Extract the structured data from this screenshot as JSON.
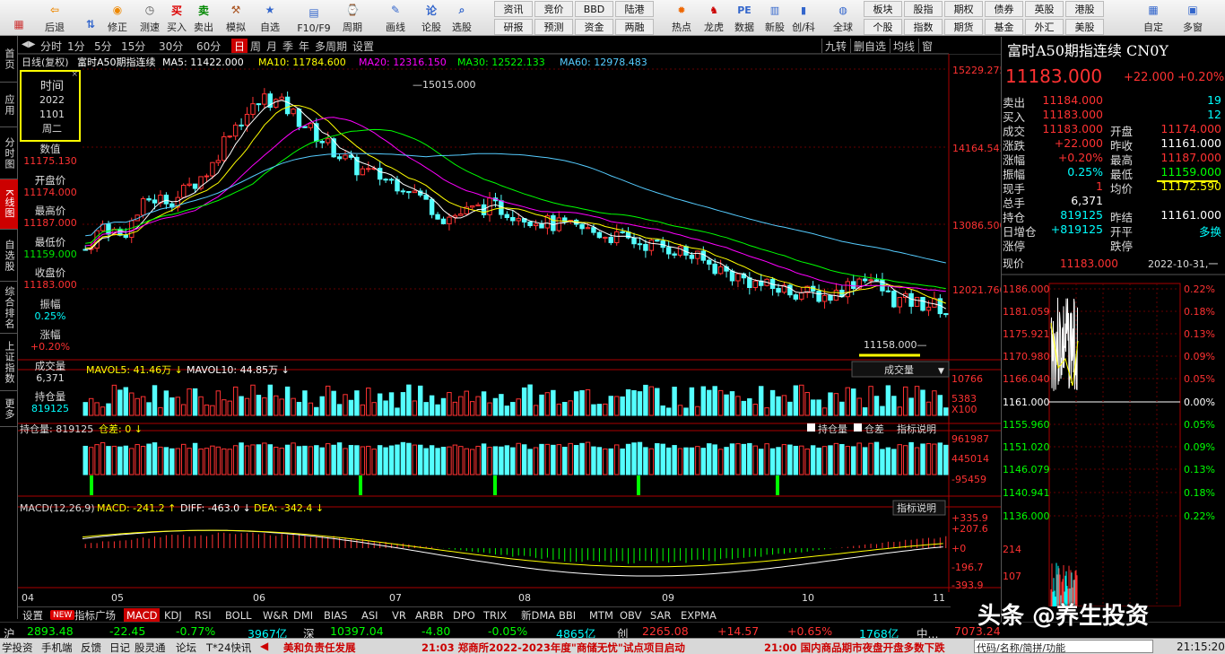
{
  "toolbar": {
    "items": [
      {
        "label": "",
        "icon": "grid-icon"
      },
      {
        "label": "后退",
        "icon": "back-arrow-icon"
      },
      {
        "label": "",
        "icon": "updown-icon"
      },
      {
        "label": "修正",
        "icon": "correct-icon"
      },
      {
        "label": "测速",
        "icon": "clock-icon"
      },
      {
        "label": "买入",
        "icon": "buy-icon",
        "glyph": "买"
      },
      {
        "label": "卖出",
        "icon": "sell-icon",
        "glyph": "卖"
      },
      {
        "label": "模拟",
        "icon": "hammer-icon"
      },
      {
        "label": "自选",
        "icon": "star-icon"
      },
      {
        "label": "F10/F9",
        "icon": "window-icon"
      },
      {
        "label": "周期",
        "icon": "period-icon"
      },
      {
        "label": "画线",
        "icon": "pen-icon"
      },
      {
        "label": "论股",
        "icon": "discuss-icon",
        "glyph": "论"
      },
      {
        "label": "选股",
        "icon": "search-icon"
      }
    ],
    "grid1": [
      [
        "资讯",
        "竞价",
        "BBD",
        "陆港"
      ],
      [
        "研报",
        "预测",
        "资金",
        "两融"
      ]
    ],
    "icons2": [
      {
        "label": "热点",
        "icon": "hot-icon"
      },
      {
        "label": "龙虎",
        "icon": "dragon-icon"
      },
      {
        "label": "数据",
        "icon": "pe-icon",
        "glyph": "PE"
      },
      {
        "label": "新股",
        "icon": "newstock-icon"
      },
      {
        "label": "创/科",
        "icon": "bar-icon"
      },
      {
        "label": "全球",
        "icon": "globe-icon"
      }
    ],
    "grid2": [
      [
        "板块",
        "股指",
        "期权",
        "债券",
        "英股",
        "港股"
      ],
      [
        "个股",
        "指数",
        "期货",
        "基金",
        "外汇",
        "美股"
      ]
    ],
    "icons3": [
      {
        "label": "自定",
        "icon": "custom-icon"
      },
      {
        "label": "多窗",
        "icon": "multiwindow-icon"
      }
    ]
  },
  "left_tabs": [
    "首页",
    "应用",
    "分时图",
    "K线图",
    "自选股",
    "综合排名",
    "上证指数",
    "更多"
  ],
  "periods": [
    "分时",
    "1分",
    "5分",
    "15分",
    "30分",
    "60分",
    "日",
    "周",
    "月",
    "季",
    "年",
    "多周期",
    "设置"
  ],
  "period_active": "日",
  "chart_tools": [
    "九转",
    "删自选",
    "均线",
    "窗"
  ],
  "ma_line": {
    "prefix": "日线(复权)",
    "name": "富时A50期指连续",
    "ma5": "MA5: 11422.000",
    "ma10": "MA10: 11784.600",
    "ma20": "MA20: 12316.150",
    "ma30": "MA30: 12522.133",
    "ma60": "MA60: 12978.483"
  },
  "price_axis": [
    "15229.275",
    "14164.543",
    "13086.500",
    "12021.760"
  ],
  "high_marker": "15015.000",
  "low_marker": "11158.000",
  "data_window": {
    "labels": [
      "时间",
      "数值",
      "开盘价",
      "最高价",
      "最低价",
      "收盘价",
      "振幅",
      "涨幅",
      "成交量",
      "持仓量"
    ],
    "date": [
      "2022",
      "1101",
      "周二"
    ],
    "values": [
      "11175.130",
      "11174.000",
      "11187.000",
      "11159.000",
      "11183.000",
      "0.25%",
      "+0.20%",
      "6,371",
      "819125"
    ]
  },
  "volume": {
    "mavol5": "MAVOL5: 41.46万",
    "mavol10": "MAVOL10: 44.85万",
    "axis": [
      "10766",
      "5383",
      "X100"
    ],
    "dropdown": "成交量"
  },
  "oi": {
    "title": "持仓量: 819125",
    "diff": "仓差: 0",
    "chk1": "持仓量",
    "chk2": "仓差",
    "help": "指标说明",
    "axis": [
      "961987",
      "445014",
      "-95459"
    ]
  },
  "macd": {
    "title": "MACD(12,26,9)",
    "macd": "MACD: -241.2",
    "diff": "DIFF: -463.0",
    "dea": "DEA: -342.4",
    "help": "指标说明",
    "axis": [
      "+335.9",
      "+207.6",
      "+0",
      "-196.7",
      "-393.9"
    ]
  },
  "months": [
    "04",
    "05",
    "06",
    "07",
    "08",
    "09",
    "10",
    "11"
  ],
  "bottom_tabs": [
    "设置",
    "NEW",
    "指标广场",
    "MACD",
    "KDJ",
    "RSI",
    "BOLL",
    "W&R",
    "DMI",
    "BIAS",
    "ASI",
    "VR",
    "ARBR",
    "DPO",
    "TRIX",
    "新DMA",
    "BBI",
    "MTM",
    "OBV",
    "SAR",
    "EXPMA"
  ],
  "bottom_active": "MACD",
  "quote": {
    "title": "富时A50期指连续 CN0Y",
    "price": "11183.000",
    "change": "+22.000",
    "pct": "+0.20%",
    "rows": [
      {
        "l1": "卖出",
        "v1": "11184.000",
        "l2": "",
        "v2": "19"
      },
      {
        "l1": "买入",
        "v1": "11183.000",
        "l2": "",
        "v2": "12"
      },
      {
        "l1": "成交",
        "v1": "11183.000",
        "l2": "开盘",
        "v2": "11174.000"
      },
      {
        "l1": "涨跌",
        "v1": "+22.000",
        "l2": "昨收",
        "v2": "11161.000"
      },
      {
        "l1": "涨幅",
        "v1": "+0.20%",
        "l2": "最高",
        "v2": "11187.000"
      },
      {
        "l1": "振幅",
        "v1": "0.25%",
        "l2": "最低",
        "v2": "11159.000"
      },
      {
        "l1": "现手",
        "v1": "1",
        "l2": "均价",
        "v2": "11172.590"
      },
      {
        "l1": "总手",
        "v1": "6,371",
        "l2": "",
        "v2": ""
      },
      {
        "l1": "持仓",
        "v1": "819125",
        "l2": "昨结",
        "v2": "11161.000"
      },
      {
        "l1": "日增仓",
        "v1": "+819125",
        "l2": "开平",
        "v2": "多换"
      },
      {
        "l1": "涨停",
        "v1": "",
        "l2": "跌停",
        "v2": ""
      }
    ]
  },
  "intraday": {
    "label": "现价",
    "price": "11183.000",
    "datetime": "2022-10-31,一",
    "left_axis": [
      "1186.000",
      "1181.059",
      "1175.921",
      "1170.980",
      "1166.040",
      "1161.000",
      "1155.960",
      "1151.020",
      "1146.079",
      "1140.941",
      "1136.000",
      "214",
      "107"
    ],
    "right_axis": [
      "0.22%",
      "0.18%",
      "0.13%",
      "0.09%",
      "0.05%",
      "0.00%",
      "0.05%",
      "0.09%",
      "0.13%",
      "0.18%",
      "0.22%"
    ]
  },
  "status1": {
    "sh_label": "沪",
    "sh": "2893.48",
    "sh_chg": "-22.45",
    "sh_pct": "-0.77%",
    "sh_amt": "3967亿",
    "sz_label": "深",
    "sz": "10397.04",
    "sz_chg": "-4.80",
    "sz_pct": "-0.05%",
    "sz_amt": "4865亿",
    "cy_label": "创",
    "cy": "2265.08",
    "cy_chg": "+14.57",
    "cy_pct": "+0.65%",
    "cy_amt": "1768亿",
    "zh_label": "中...",
    "zh": "7073.24"
  },
  "watermark": "头条 @养生投资",
  "status2": {
    "items": [
      "学投资",
      "手机端",
      "反馈",
      "日记",
      "股灵通",
      "论坛",
      "T*24快讯"
    ],
    "news1": "美和负责任发展",
    "news2": "21:03 郑商所2022-2023年度\"商储无忧\"试点项目启动",
    "news3": "21:00 国内商品期市夜盘开盘多数下跌",
    "search": "代码/名称/简拼/功能",
    "time": "21:15:20"
  },
  "chart_data": {
    "type": "candlestick",
    "ohlc_summary": {
      "last_close": 11183.0,
      "period_high": 15015.0,
      "period_low": 11158.0
    },
    "y_range": [
      11000,
      15400
    ],
    "months": [
      "04",
      "05",
      "06",
      "07",
      "08",
      "09",
      "10",
      "11"
    ]
  }
}
